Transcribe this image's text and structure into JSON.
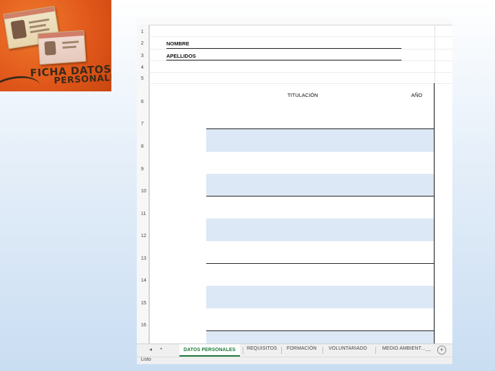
{
  "photo": {
    "caption_line1": "FICHA DATOS",
    "caption_line2": "PERSONALES",
    "card_icon": "id-card-icon"
  },
  "sheet": {
    "row_numbers": [
      "1",
      "2",
      "3",
      "4",
      "5",
      "6",
      "7",
      "8",
      "9",
      "10",
      "11",
      "12",
      "13",
      "14",
      "15",
      "16"
    ],
    "fields": {
      "nombre_label": "NOMBRE",
      "apellidos_label": "APELLIDOS"
    },
    "table": {
      "col_titulacion": "TITULACIÓN",
      "col_ano": "AÑO"
    }
  },
  "tabs": {
    "nav_prev": "◂",
    "nav_more": "•",
    "items": [
      "DATOS PERSONALES",
      "REQUISITOS",
      "FORMACIÓN",
      "VOLUNTARIADO",
      "MEDIO AMBIENT..."
    ],
    "more": "...",
    "add": "+",
    "active_index": 0
  },
  "status": {
    "text": "Listo"
  },
  "colors": {
    "band": "#dce8f5",
    "active_tab": "#1e7a3c",
    "photo_bg": "#e0561a"
  }
}
